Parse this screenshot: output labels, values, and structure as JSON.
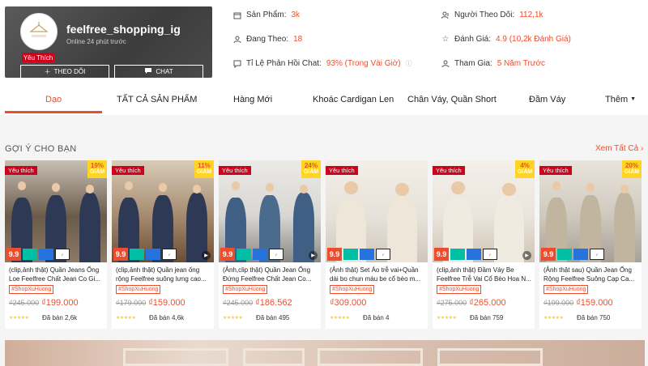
{
  "shop": {
    "name": "feelfree_shopping_ig",
    "online": "Online 24 phút trước",
    "favorite": "Yêu Thích",
    "follow": "THEO DÕI",
    "chat": "CHAT",
    "stats": {
      "products_label": "Sản Phẩm:",
      "products_value": "3k",
      "following_label": "Đang Theo:",
      "following_value": "18",
      "response_label": "Tỉ Lệ Phản Hồi Chat:",
      "response_value": "93% (Trong Vài Giờ)",
      "followers_label": "Người Theo Dõi:",
      "followers_value": "112,1k",
      "rating_label": "Đánh Giá:",
      "rating_value": "4.9 (10,2k Đánh Giá)",
      "joined_label": "Tham Gia:",
      "joined_value": "5 Năm Trước"
    }
  },
  "tabs": [
    "Dạo",
    "TẤT CẢ SẢN PHẨM",
    "Hàng Mới",
    "Khoác Cardigan Len",
    "Chân Váy, Quần Short",
    "Đầm Váy",
    "Thêm"
  ],
  "section": {
    "title": "GỢI Ý CHO BẠN",
    "see_all": "Xem Tất Cả"
  },
  "badges": {
    "fav": "Yêu thích",
    "sale": "9.9",
    "discount_label": "GIẢM"
  },
  "products": [
    {
      "name": "(clip,ảnh thật) Quần Jeans Ống Loe Feelfree Chất Jean Co Gi...",
      "hashtag": "#ShopXuHuong",
      "old_price": "₫245.000",
      "price": "₫199.000",
      "sold": "Đã bán 2,6k",
      "discount": "19%"
    },
    {
      "name": "(clip,ảnh thật) Quần jean ống rộng Feelfree suông lưng cao...",
      "hashtag": "#ShopXuHuong",
      "old_price": "₫179.000",
      "price": "₫159.000",
      "sold": "Đã bán 4,6k",
      "discount": "11%"
    },
    {
      "name": "(Ảnh,clip thật) Quần Jean Ống Đứng Feelfree Chất Jean Co...",
      "hashtag": "#ShopXuHuong",
      "old_price": "₫245.000",
      "price": "₫186.562",
      "sold": "Đã bán 495",
      "discount": "24%"
    },
    {
      "name": "(Ảnh thật) Set Áo trễ vai+Quần dài bo chun màu be cổ bèo m...",
      "hashtag": "#ShopXuHuong",
      "old_price": "",
      "price": "₫309.000",
      "sold": "Đã bán 4",
      "discount": ""
    },
    {
      "name": "(clip,ảnh thật) Đầm Váy Be Feelfree Trễ Vai Cổ Bèo Hoa N...",
      "hashtag": "#ShopXuHuong",
      "old_price": "₫275.000",
      "price": "₫265.000",
      "sold": "Đã bán 759",
      "discount": "4%"
    },
    {
      "name": "(Ảnh thật sau) Quần Jean Ống Rộng Feelfree Suông Cạp Ca...",
      "hashtag": "#ShopXuHuong",
      "old_price": "₫199.000",
      "price": "₫159.000",
      "sold": "Đã bán 750",
      "discount": "20%"
    }
  ],
  "colors": {
    "accent": "#ee4d2d",
    "fav_red": "#d0011b",
    "discount_yellow": "#ffd424"
  }
}
